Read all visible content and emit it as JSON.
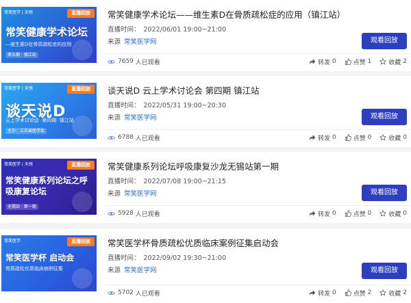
{
  "labels": {
    "live_time": "直播时间：",
    "source": "来源",
    "watch_button": "观看回放",
    "views_suffix": "人已观看",
    "share": "转发",
    "like": "点赞",
    "favorite": "收藏"
  },
  "colors": {
    "button_bg": "#2d3fbf",
    "link": "#2b6fd6",
    "live_badge": "#ff7b1e"
  },
  "items": [
    {
      "title": "常笑健康学术论坛——维生素D在骨质疏松症的应用（镇江站）",
      "time": "2022/06/01 19:00~21:00",
      "source": "常笑医学网",
      "views": "7659",
      "share": "0",
      "like": "1",
      "favorite": "2",
      "thumb": {
        "orgs": "常笑医学 | 天悦",
        "badge": "直播回放",
        "big": "常笑健康学术论坛",
        "sub": "—维生素D在骨质疏松症的应用",
        "tag": "第五期 · 镇江站"
      }
    },
    {
      "title": "谈天说D 云上学术讨论会 第四期 镇江站",
      "time": "2022/05/31 19:00~20:30",
      "source": "常笑医学网",
      "views": "6788",
      "share": "0",
      "like": "0",
      "favorite": "0",
      "thumb": {
        "orgs": "常笑医学 | 天悦",
        "badge": "直播回放",
        "big": "谈天说D",
        "sub": "云上学术讨论会 ·第四期· 镇江站",
        "tag": "主办：江苏省医学会"
      }
    },
    {
      "title": "常笑健康系列论坛呼吸康复沙龙无锡站第一期",
      "time": "2022/07/08 19:00~21:15",
      "source": "常笑医学网",
      "views": "5928",
      "share": "0",
      "like": "0",
      "favorite": "0",
      "thumb": {
        "orgs": "常笑医学 | 天悦",
        "badge": "直播回放",
        "big": "常笑健康系列论坛之呼吸康复论坛",
        "sub": "",
        "tag": "无锡站 · 第一期"
      }
    },
    {
      "title": "常笑医学杯骨质疏松优质临床案例征集启动会",
      "time": "2022/09/02 19:30~21:00",
      "source": "常笑医学网",
      "views": "5702",
      "share": "0",
      "like": "2",
      "favorite": "2",
      "thumb": {
        "orgs": "常笑医学",
        "badge": "直播回放",
        "big": "常笑医学杯 启动会",
        "sub": "骨质疏松优质临床病例征集",
        "tag": ""
      }
    }
  ]
}
